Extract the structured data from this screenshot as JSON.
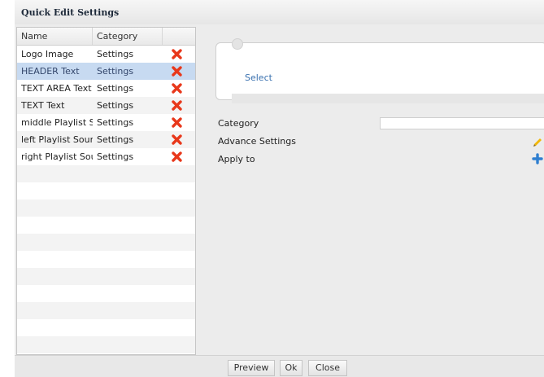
{
  "dialog": {
    "title": "Quick Edit Settings"
  },
  "grid": {
    "columns": [
      "Name",
      "Category"
    ],
    "rows": [
      {
        "name": "Logo Image",
        "category": "Settings",
        "action": "delete-icon"
      },
      {
        "name": "HEADER Text",
        "category": "Settings",
        "action": "delete-icon",
        "selected": true
      },
      {
        "name": "TEXT AREA Text",
        "category": "Settings",
        "action": "delete-icon"
      },
      {
        "name": "TEXT Text",
        "category": "Settings",
        "action": "delete-icon"
      },
      {
        "name": "middle Playlist S",
        "category": "Settings",
        "action": "delete-icon"
      },
      {
        "name": "left Playlist Sour",
        "category": "Settings",
        "action": "delete-icon"
      },
      {
        "name": "right Playlist Sou",
        "category": "Settings",
        "action": "delete-icon"
      }
    ]
  },
  "editor": {
    "select_label": "Select",
    "properties": {
      "category": "Category",
      "advance_settings": "Advance Settings",
      "apply_to": "Apply to"
    },
    "category_value": ""
  },
  "footer": {
    "preview": "Preview",
    "ok": "Ok",
    "close": "Close"
  },
  "colors": {
    "selected_row": "#c7daf1",
    "delete_icon": "#e8381b",
    "link": "#3b72b0",
    "add_icon": "#2f7fd0",
    "edit_icon": "#f2b705"
  }
}
